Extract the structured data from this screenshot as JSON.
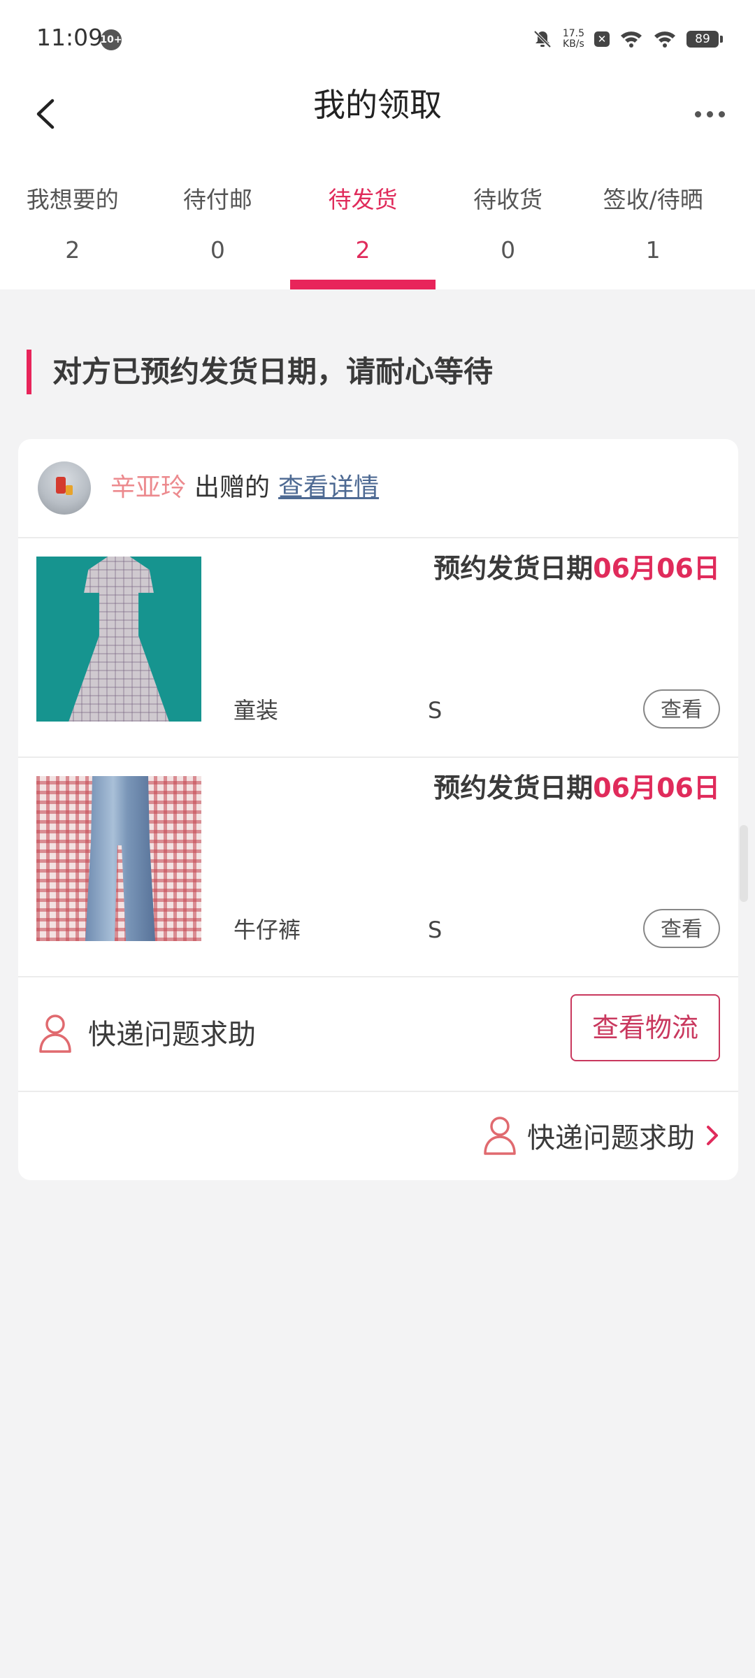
{
  "status_bar": {
    "time": "11:09",
    "notif_badge": "10+",
    "net_speed_value": "17.5",
    "net_speed_unit": "KB/s",
    "battery": "89"
  },
  "header": {
    "title": "我的领取"
  },
  "tabs": [
    {
      "label": "我想要的",
      "count": "2"
    },
    {
      "label": "待付邮",
      "count": "0"
    },
    {
      "label": "待发货",
      "count": "2"
    },
    {
      "label": "待收货",
      "count": "0"
    },
    {
      "label": "签收/待晒",
      "count": "1"
    }
  ],
  "active_tab_index": 2,
  "section_title": "对方已预约发货日期，请耐心等待",
  "giver": {
    "name": "辛亚玲",
    "action": "出赠的",
    "link": "查看详情"
  },
  "items": [
    {
      "ship_label": "预约发货日期",
      "ship_date": "06月06日",
      "name": "童装",
      "size": "S",
      "view": "查看"
    },
    {
      "ship_label": "预约发货日期",
      "ship_date": "06月06日",
      "name": "牛仔裤",
      "size": "S",
      "view": "查看"
    }
  ],
  "help": {
    "label": "快递问题求助",
    "logistics_button": "查看物流",
    "link_label": "快递问题求助"
  },
  "colors": {
    "accent": "#e8245a",
    "name_pink": "#ec8a8e",
    "link_blue": "#4e6a93",
    "button_red": "#c9385e",
    "background": "#f3f3f4"
  }
}
